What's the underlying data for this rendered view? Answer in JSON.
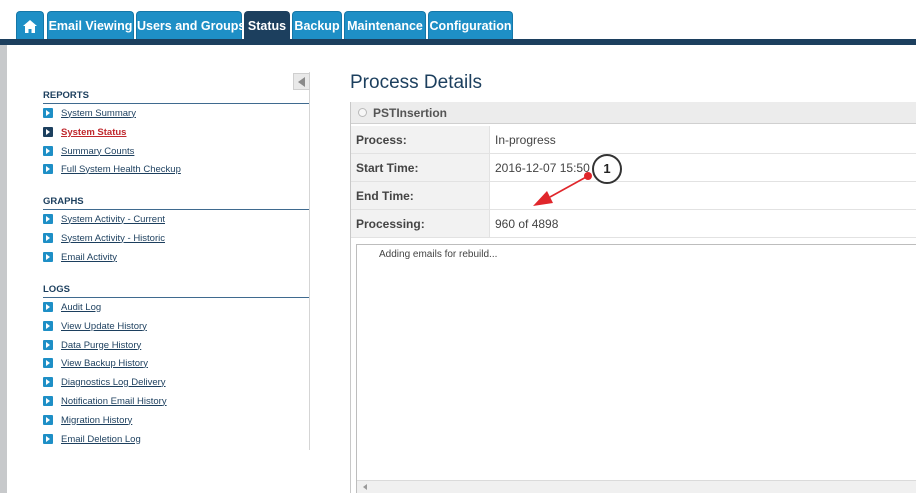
{
  "tabs": {
    "home_icon": "home-icon",
    "items": [
      "Email Viewing",
      "Users and Groups",
      "Status",
      "Backup",
      "Maintenance",
      "Configuration"
    ],
    "active": "Status"
  },
  "sidebar": {
    "reports_title": "REPORTS",
    "reports": [
      "System Summary",
      "System Status",
      "Summary Counts",
      "Full System Health Checkup"
    ],
    "graphs_title": "GRAPHS",
    "graphs": [
      "System Activity - Current",
      "System Activity - Historic",
      "Email Activity"
    ],
    "logs_title": "LOGS",
    "logs": [
      "Audit Log",
      "View Update History",
      "Data Purge History",
      "View Backup History",
      "Diagnostics Log Delivery",
      "Notification Email History",
      "Migration History",
      "Email Deletion Log"
    ]
  },
  "main": {
    "title": "Process Details",
    "panel_label": "PSTInsertion",
    "details": {
      "process_label": "Process:",
      "process_value": "In-progress",
      "start_label": "Start Time:",
      "start_value": "2016-12-07 15:50",
      "end_label": "End Time:",
      "end_value": "",
      "processing_label": "Processing:",
      "processing_value": "960 of 4898"
    },
    "log_text": "Adding emails for rebuild..."
  },
  "annotation": {
    "badge": "1",
    "color": "#e0262b"
  },
  "colors": {
    "tab_blue": "#1e8fc6",
    "tab_active": "#1c3f5e",
    "link_active": "#c0282d"
  }
}
